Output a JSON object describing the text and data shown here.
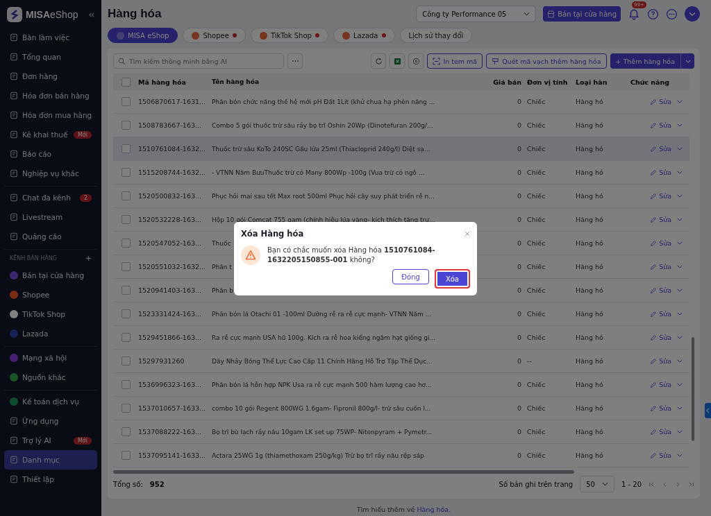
{
  "sidebar": {
    "logo": "**MISA**eShop",
    "sections": [
      {
        "items": [
          {
            "label": "Bàn làm việc",
            "kind": "nav",
            "selected": false
          },
          {
            "label": "Tổng quan",
            "kind": "nav",
            "selected": false
          },
          {
            "label": "Đơn hàng",
            "kind": "nav",
            "selected": false
          },
          {
            "label": "Hóa đơn bán hàng",
            "kind": "nav",
            "selected": false
          },
          {
            "label": "Hóa đơn mua hàng",
            "kind": "nav",
            "selected": false
          },
          {
            "label": "Kê khai thuế",
            "kind": "nav",
            "selected": false,
            "badge": "Mới"
          },
          {
            "label": "Báo cáo",
            "kind": "nav",
            "selected": false
          },
          {
            "label": "Nghiệp vụ khác",
            "kind": "nav",
            "selected": false
          }
        ]
      },
      {
        "items": [
          {
            "label": "Chat đa kênh",
            "kind": "nav",
            "selected": false,
            "badge": "2"
          },
          {
            "label": "Livestream",
            "kind": "nav",
            "selected": false
          },
          {
            "label": "Quảng cáo",
            "kind": "nav",
            "selected": false
          }
        ]
      },
      {
        "heading": "KÊNH BÁN HÀNG",
        "items": [
          {
            "label": "Bán tại cửa hàng",
            "kind": "channel",
            "color": "#3e266f",
            "selected": false
          },
          {
            "label": "Shopee",
            "kind": "channel",
            "color": "#782d14",
            "selected": false
          },
          {
            "label": "TikTok Shop",
            "kind": "channel",
            "color": "#808080",
            "selected": false
          },
          {
            "label": "Lazada",
            "kind": "channel",
            "color": "#152054",
            "selected": false
          }
        ]
      },
      {
        "items": [
          {
            "label": "Mạng xã hội",
            "kind": "channel",
            "color": "#461f70",
            "selected": false
          },
          {
            "label": "Nguồn khác",
            "kind": "channel",
            "color": "#185428",
            "selected": false
          }
        ]
      },
      {
        "items": [
          {
            "label": "Kế toán dịch vụ",
            "kind": "channel",
            "color": "#104d2c",
            "selected": false
          },
          {
            "label": "Ứng dụng",
            "kind": "nav",
            "selected": false
          },
          {
            "label": "Trợ lý AI",
            "kind": "nav",
            "selected": false,
            "badge": "Mới"
          },
          {
            "label": "Danh mục",
            "kind": "nav",
            "selected": true
          },
          {
            "label": "Thiết lập",
            "kind": "nav",
            "selected": false
          }
        ]
      }
    ]
  },
  "header": {
    "title": "Hàng hóa",
    "company": "Công ty Performance 05",
    "store_button": "Bán tại cửa hàng",
    "notifications": "99+"
  },
  "tabs": [
    {
      "label": "MISA eShop",
      "selected": true,
      "alert": false,
      "logo": true
    },
    {
      "label": "Shopee",
      "selected": false,
      "alert": true,
      "logo": true
    },
    {
      "label": "TikTok Shop",
      "selected": false,
      "alert": true,
      "logo": true
    },
    {
      "label": "Lazada",
      "selected": false,
      "alert": true,
      "logo": true
    },
    {
      "label": "Lịch sử thay đổi",
      "selected": false,
      "alert": false,
      "logo": false
    }
  ],
  "toolbar": {
    "search": {
      "placeholder": "Tìm kiếm thông minh bằng AI"
    },
    "print_button": "In tem mã",
    "scan_button": "Quét mã vạch thêm hàng hóa",
    "add_button": "+ Thêm hàng hóa"
  },
  "table": {
    "all_checked": false,
    "columns": [
      "Mã hàng hóa",
      "Tên hàng hóa",
      "Giá bán",
      "Đơn vị tính",
      "Loại hàn",
      "Chức năng"
    ],
    "rows": [
      {
        "code": "1506870617-1631...",
        "name": "Phân bón chức năng thế hệ mới pH Đất 1Lit (khử chua hạ phèn nâng ...",
        "price": "0",
        "unit": "Chiếc",
        "type": "Hàng hó",
        "action": "Sửa",
        "checked": false,
        "highlighted": false
      },
      {
        "code": "1508783667-163...",
        "name": "Combo 5 gói thuốc trừ sâu rầy bọ trĩ Oshin 20Wp (Dinotefuran 200g/...",
        "price": "0",
        "unit": "Chiếc",
        "type": "Hàng hó",
        "action": "Sửa",
        "checked": false,
        "highlighted": false
      },
      {
        "code": "1510761084-1632...",
        "name": "Thuốc trừ sâu KoTo 240SC Gấu lửa 25ml (Thiacloprid 240g/l) Diệt sạ...",
        "price": "0",
        "unit": "Chiếc",
        "type": "Hàng hó",
        "action": "Sửa",
        "checked": false,
        "highlighted": true
      },
      {
        "code": "1515208744-1632...",
        "name": "- VTNN Năm BưuThuốc trừ cỏ Many 800Wp -100g (Vua trừ cỏ ngô ...",
        "price": "0",
        "unit": "Chiếc",
        "type": "Hàng hó",
        "action": "Sửa",
        "checked": false,
        "highlighted": false
      },
      {
        "code": "1520500832-163...",
        "name": "Phục hồi mai sau tết Max root 500ml Phục hồi cây suy phát triển rễ n...",
        "price": "0",
        "unit": "Chiếc",
        "type": "Hàng hó",
        "action": "Sửa",
        "checked": false,
        "highlighted": false
      },
      {
        "code": "1520532228-163...",
        "name": "Hộp 10 gói Comcat 755 gam (chính hiệu lúa vàng- kích thích tăng trư...",
        "price": "0",
        "unit": "Chiếc",
        "type": "Hàng hó",
        "action": "Sửa",
        "checked": false,
        "highlighted": false
      },
      {
        "code": "1520547052-163...",
        "name": "Thuốc",
        "price": "0",
        "unit": "Chiếc",
        "type": "Hàng hó",
        "action": "Sửa",
        "checked": false,
        "highlighted": false
      },
      {
        "code": "1520551032-1632...",
        "name": "Phân t",
        "price": "0",
        "unit": "Chiếc",
        "type": "Hàng hó",
        "action": "Sửa",
        "checked": false,
        "highlighted": false
      },
      {
        "code": "1520941403-163...",
        "name": "Phân b",
        "price": "0",
        "unit": "Chiếc",
        "type": "Hàng hó",
        "action": "Sửa",
        "checked": false,
        "highlighted": false
      },
      {
        "code": "1523331424-163...",
        "name": "Phân bón lá Otachi 01 -100ml Dưỡng rễ ra rễ cực mạnh- VTNN Năm ...",
        "price": "0",
        "unit": "Chiếc",
        "type": "Hàng hó",
        "action": "Sửa",
        "checked": false,
        "highlighted": false
      },
      {
        "code": "1529451866-163...",
        "name": "Ra rễ cực mạnh USA hũ 100g. Kích ra rễ hoa kiểng ngâm hạt giống gi...",
        "price": "0",
        "unit": "Chiếc",
        "type": "Hàng hó",
        "action": "Sửa",
        "checked": false,
        "highlighted": false
      },
      {
        "code": "15297931260",
        "name": "Dây Nhảy Bóng Thể Lực Cao Cấp 11 Chính Hãng Hỗ Trợ Tập Thể Dục...",
        "price": "0",
        "unit": "--",
        "type": "Hàng hó",
        "action": "Sửa",
        "checked": false,
        "highlighted": false
      },
      {
        "code": "1536996323-163...",
        "name": "Phân bón lá hỗn hợp NPK Usa ra rễ cực mạnh 500 hàm lượng cao hơ...",
        "price": "0",
        "unit": "Chiếc",
        "type": "Hàng hó",
        "action": "Sửa",
        "checked": false,
        "highlighted": false
      },
      {
        "code": "1537010657-1633...",
        "name": "combo 10 gói Regent 800WG 1.6gam- Fipronil 800g/l- trừ sâu cuốn l...",
        "price": "0",
        "unit": "Chiếc",
        "type": "Hàng hó",
        "action": "Sửa",
        "checked": false,
        "highlighted": false
      },
      {
        "code": "1537088222-163...",
        "name": "Bọ trĩ bù lạch rầy nâu 10gam  LK set up 75WP- Nitenpyram + Pymetr...",
        "price": "0",
        "unit": "Chiếc",
        "type": "Hàng hó",
        "action": "Sửa",
        "checked": false,
        "highlighted": false
      },
      {
        "code": "1537095141-1633...",
        "name": "Actara 25WG 1g (thiamethoxam 250g/kg) Trừ bọ trĩ rầy nâu rệp sáp",
        "price": "0",
        "unit": "Chiếc",
        "type": "Hàng hó",
        "action": "Sửa",
        "checked": false,
        "highlighted": false
      }
    ]
  },
  "footer": {
    "total_label": "Tổng số:",
    "total": "952",
    "page_size_label": "Số bản ghi trên trang",
    "page_size": "50",
    "range": "1 - 20"
  },
  "help": {
    "text": "Tìm hiểu thêm về",
    "link": "Hàng hóa."
  },
  "dialog": {
    "title": "Xóa Hàng hóa",
    "message": "Bạn có chắc muốn xóa Hàng hóa **1510761084-1632205150855-001** không?",
    "buttons": [
      {
        "label": "Đóng",
        "kind": "secondary",
        "focused": false
      },
      {
        "label": "Xóa",
        "kind": "primary",
        "focused": true
      }
    ]
  }
}
